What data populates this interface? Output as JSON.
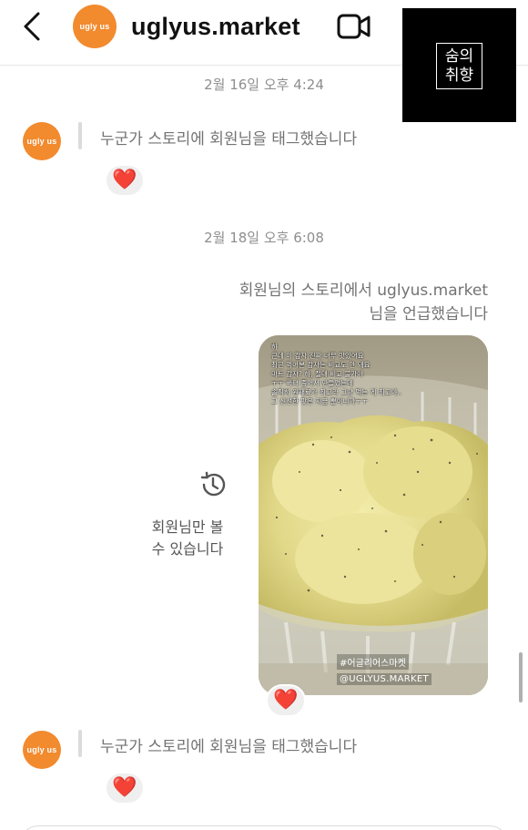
{
  "header": {
    "title": "uglyus.market",
    "avatar_logo": "ugly us",
    "back_icon": "chevron-left-icon",
    "video_icon": "video-camera-icon",
    "brand_badge": {
      "line1": "숨의",
      "line2": "취향"
    }
  },
  "messages": [
    {
      "type": "timestamp",
      "text": "2월 16일 오후 4:24"
    },
    {
      "type": "story_tag",
      "avatar_logo": "ugly us",
      "text": "누군가 스토리에 회원님을 태그했습니다",
      "reaction": "❤️"
    },
    {
      "type": "timestamp",
      "text": "2월 18일 오후 6:08"
    },
    {
      "type": "story_mention",
      "text_line1": "회원님의 스토리에서 uglyus.market",
      "text_line2": "님을 언급했습니다",
      "private_icon": "history-clock-icon",
      "private_line1": "회원님만 볼",
      "private_line2": "수 있습니다",
      "story": {
        "caption": "하\n근데 이 감자 진짜 너무 맛있어요\n최근 먹어본 감자는 비교도 안 돼요\n마트 감자? 하, 절대 비교 불가야\nㅜㅜ 버터 좀어서 만들었는데\n솔직히 원재료가 최고라 그냥 먹는 게 최고야..\n그 신선한 맛은 지금 뿐이니까ㅜㅜ",
        "hashtag": "#어글리어스마켓",
        "handle": "@UGLYUS.MARKET"
      },
      "reaction": "❤️"
    },
    {
      "type": "story_tag",
      "avatar_logo": "ugly us",
      "text": "누군가 스토리에 회원님을 태그했습니다",
      "reaction": "❤️"
    }
  ],
  "colors": {
    "accent": "#f28a2e",
    "heart": "#e0242d",
    "meta": "#8e8e8e"
  }
}
